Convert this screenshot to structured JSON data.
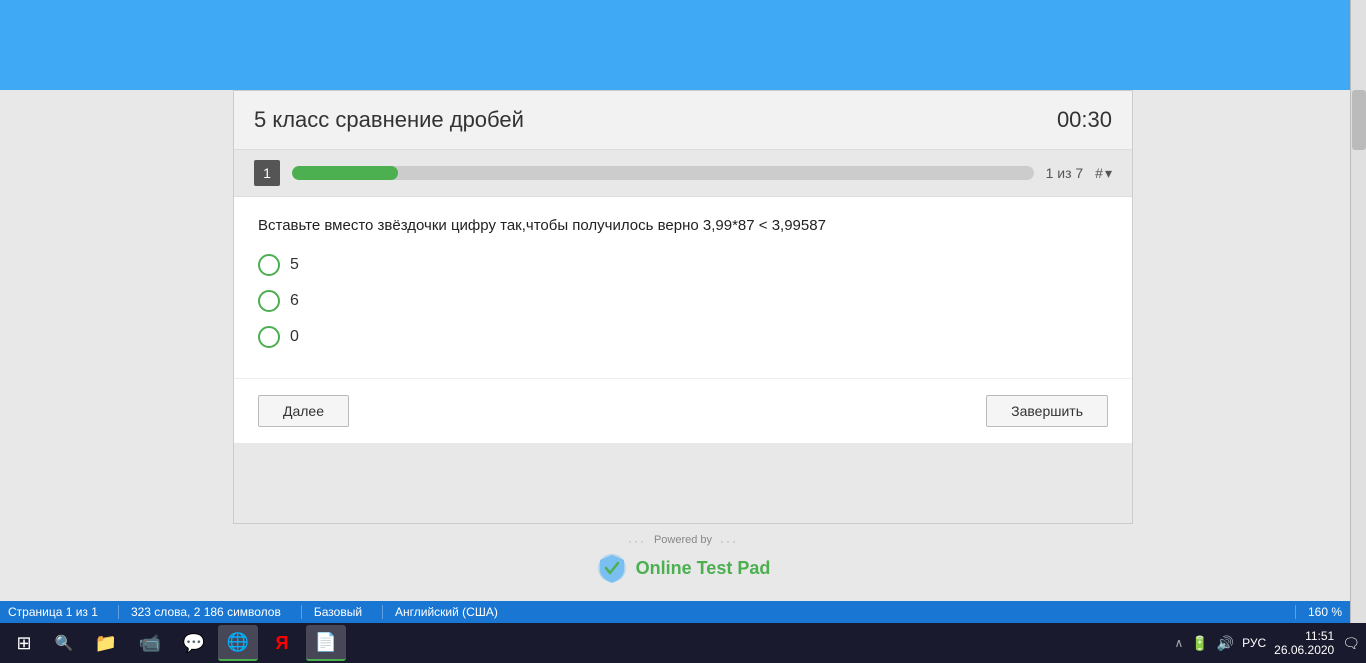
{
  "header": {
    "title": "5 класс сравнение дробей",
    "timer": "00:30"
  },
  "progress": {
    "question_number": "1",
    "progress_label": "1 из 7",
    "hash_label": "#",
    "progress_percent": 14.28
  },
  "question": {
    "text": "Вставьте вместо звёздочки цифру так,чтобы получилось верно   3,99*87 < 3,99587",
    "options": [
      {
        "id": "opt1",
        "value": "5"
      },
      {
        "id": "opt2",
        "value": "6"
      },
      {
        "id": "opt3",
        "value": "0"
      }
    ]
  },
  "buttons": {
    "next": "Далее",
    "finish": "Завершить"
  },
  "footer": {
    "powered_by": "Powered by",
    "brand": "Online Test Pad"
  },
  "status_bar": {
    "pages": "Страница 1 из 1",
    "words": "323 слова, 2 186 символов",
    "mode": "Базовый",
    "language": "Английский (США)",
    "zoom": "160 %"
  },
  "taskbar": {
    "time": "11:51",
    "date": "26.06.2020",
    "language": "РУС"
  }
}
